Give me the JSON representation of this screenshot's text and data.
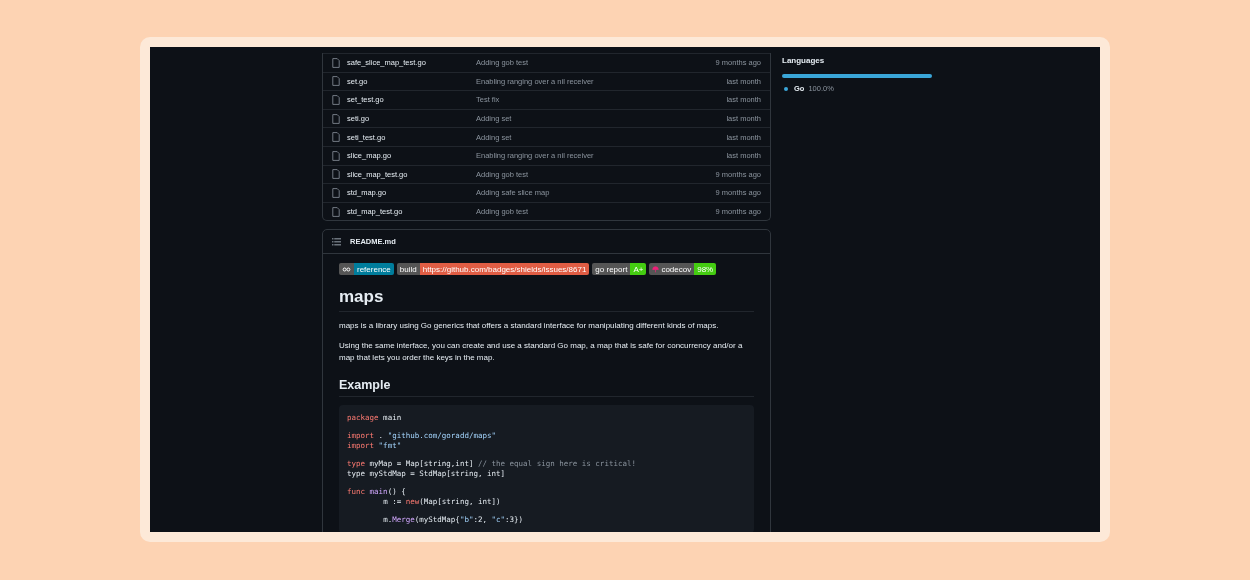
{
  "files": [
    {
      "name": "safe_slice_map_test.go",
      "message": "Adding gob test",
      "time": "9 months ago"
    },
    {
      "name": "set.go",
      "message": "Enabling ranging over a nil receiver",
      "time": "last month"
    },
    {
      "name": "set_test.go",
      "message": "Test fix",
      "time": "last month"
    },
    {
      "name": "seti.go",
      "message": "Adding set",
      "time": "last month"
    },
    {
      "name": "seti_test.go",
      "message": "Adding set",
      "time": "last month"
    },
    {
      "name": "slice_map.go",
      "message": "Enabling ranging over a nil receiver",
      "time": "last month"
    },
    {
      "name": "slice_map_test.go",
      "message": "Adding gob test",
      "time": "9 months ago"
    },
    {
      "name": "std_map.go",
      "message": "Adding safe slice map",
      "time": "9 months ago"
    },
    {
      "name": "std_map_test.go",
      "message": "Adding gob test",
      "time": "9 months ago"
    }
  ],
  "readme": {
    "filename": "README.md",
    "badges": [
      {
        "kind": "link",
        "value": "reference",
        "color": "#007d9c"
      },
      {
        "kind": "plain",
        "label": "build",
        "value": "https://github.com/badges/shields/issues/8671",
        "color": "#e05d44"
      },
      {
        "kind": "plain",
        "label": "go report",
        "value": "A+",
        "color": "#44cc11"
      },
      {
        "kind": "codecov",
        "label": "codecov",
        "value": "98%",
        "color": "#4c1"
      }
    ],
    "title": "maps",
    "paragraphs": [
      "maps is a library using Go generics that offers a standard interface for manipulating different kinds of maps.",
      "Using the same interface, you can create and use a standard Go map, a map that is safe for concurrency and/or a map that lets you order the keys in the map."
    ],
    "section_heading": "Example",
    "code_blocks": [
      [
        [
          {
            "kind": "keyword",
            "text": "package"
          },
          {
            "kind": "plain",
            "text": " main"
          }
        ]
      ],
      [
        [
          {
            "kind": "keyword",
            "text": "import"
          },
          {
            "kind": "plain",
            "text": " . "
          },
          {
            "kind": "string",
            "text": "\"github.com/goradd/maps\""
          }
        ],
        [
          {
            "kind": "keyword",
            "text": "import"
          },
          {
            "kind": "string",
            "text": " \"fmt\""
          }
        ]
      ],
      [
        [
          {
            "kind": "keyword",
            "text": "type"
          },
          {
            "kind": "plain",
            "text": " myMap = Map[string,int] "
          },
          {
            "kind": "comment",
            "text": "// the equal sign here is critical!"
          }
        ],
        [
          {
            "kind": "plain",
            "text": "type myStdMap = StdMap[string, int]"
          }
        ]
      ],
      [
        [
          {
            "kind": "keyword",
            "text": "func "
          },
          {
            "kind": "func",
            "text": "main"
          },
          {
            "kind": "plain",
            "text": "() {"
          }
        ],
        [
          {
            "kind": "plain",
            "text": "\tm := "
          },
          {
            "kind": "keyword",
            "text": "new"
          },
          {
            "kind": "plain",
            "text": "(Map[string, int])"
          }
        ]
      ],
      [
        [
          {
            "kind": "plain",
            "text": "\tm."
          },
          {
            "kind": "func",
            "text": "Merge"
          },
          {
            "kind": "plain",
            "text": "(myStdMap{"
          },
          {
            "kind": "string",
            "text": "\"b\""
          },
          {
            "kind": "plain",
            "text": ":2, "
          },
          {
            "kind": "string",
            "text": "\"c\""
          },
          {
            "kind": "plain",
            "text": ":3})"
          }
        ]
      ]
    ]
  },
  "languages": {
    "heading": "Languages",
    "items": [
      {
        "name": "Go",
        "percent": "100.0%",
        "level": 1,
        "color": "#3aa6d8"
      }
    ]
  }
}
